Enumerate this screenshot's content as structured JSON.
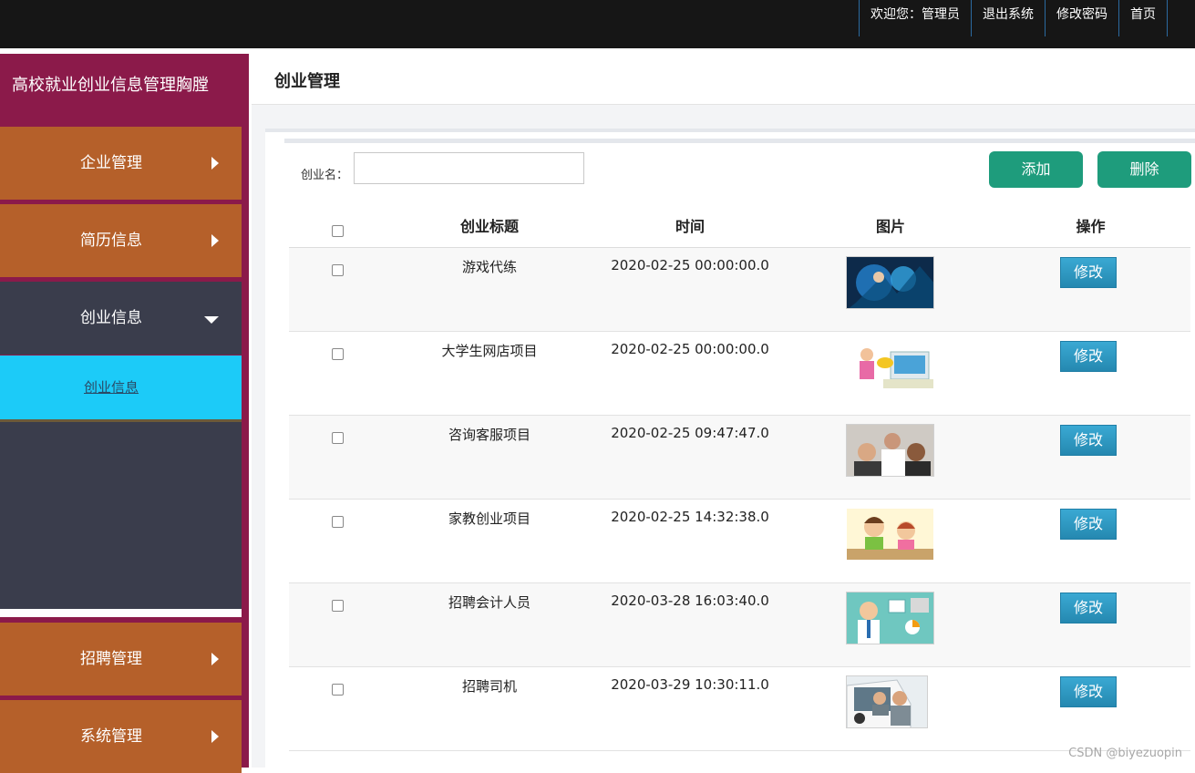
{
  "topnav": {
    "welcome": "欢迎您：管理员",
    "logout": "退出系统",
    "change_password": "修改密码",
    "home": "首页"
  },
  "sidebar": {
    "brand": "高校就业创业信息管理胸膛",
    "items": [
      {
        "label": "企业管理"
      },
      {
        "label": "简历信息"
      },
      {
        "label": "创业信息"
      },
      {
        "label": "招聘管理"
      },
      {
        "label": "系统管理"
      }
    ],
    "active_sub": "创业信息"
  },
  "page": {
    "title": "创业管理"
  },
  "toolbar": {
    "search_label": "创业名：",
    "search_value": "",
    "add_label": "添加",
    "delete_label": "删除"
  },
  "table": {
    "headers": [
      "创业标题",
      "时间",
      "图片",
      "操作"
    ],
    "edit_label": "修改",
    "rows": [
      {
        "title": "游戏代练",
        "time": "2020-02-25 00:00:00.0"
      },
      {
        "title": "大学生网店项目",
        "time": "2020-02-25 00:00:00.0"
      },
      {
        "title": "咨询客服项目",
        "time": "2020-02-25 09:47:47.0"
      },
      {
        "title": "家教创业项目",
        "time": "2020-02-25 14:32:38.0"
      },
      {
        "title": "招聘会计人员",
        "time": "2020-03-28 16:03:40.0"
      },
      {
        "title": "招聘司机",
        "time": "2020-03-29 10:30:11.0"
      }
    ]
  },
  "watermark": "CSDN @biyezuopin",
  "colors": {
    "topbar": "#161616",
    "sidebar": "#8b1a4a",
    "menu_item": "#b5602a",
    "menu_open": "#3a3d4c",
    "submenu_active": "#1ccbf8",
    "button_green": "#1e9c7c",
    "button_edit": "#2e9bc3"
  }
}
